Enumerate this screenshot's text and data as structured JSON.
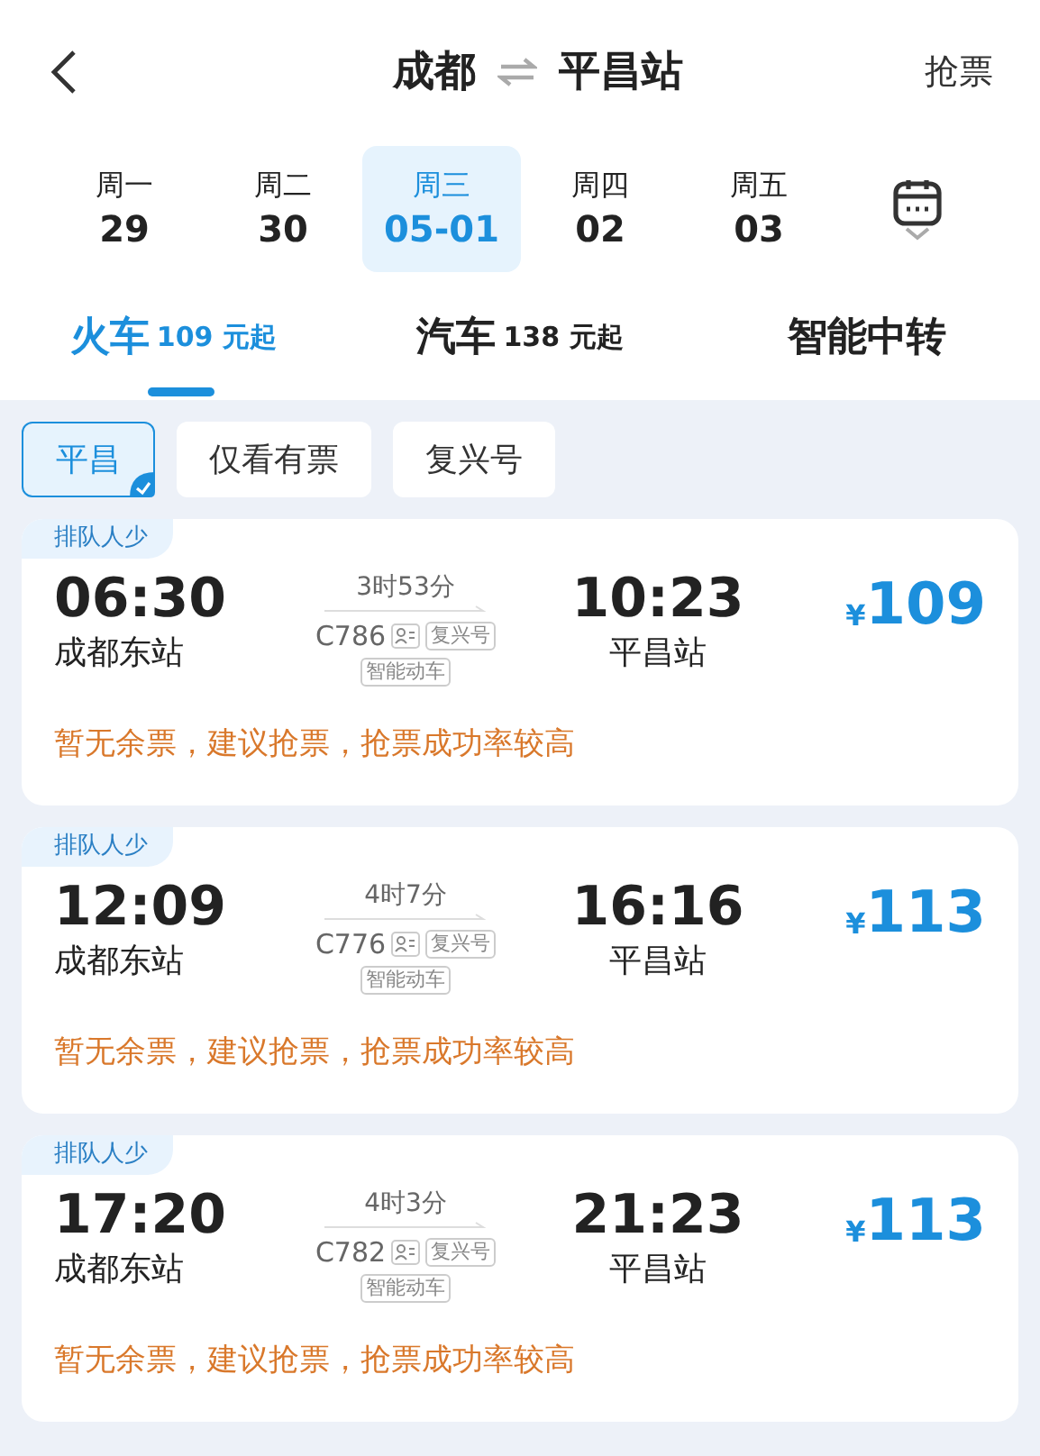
{
  "header": {
    "from": "成都",
    "to": "平昌站",
    "action": "抢票"
  },
  "dates": [
    {
      "weekday": "周一",
      "date": "29",
      "selected": false
    },
    {
      "weekday": "周二",
      "date": "30",
      "selected": false
    },
    {
      "weekday": "周三",
      "date": "05-01",
      "selected": true
    },
    {
      "weekday": "周四",
      "date": "02",
      "selected": false
    },
    {
      "weekday": "周五",
      "date": "03",
      "selected": false
    }
  ],
  "modes": [
    {
      "label": "火车",
      "price": "109 元起",
      "selected": true
    },
    {
      "label": "汽车",
      "price": "138 元起",
      "selected": false
    },
    {
      "label": "智能中转",
      "selected": false
    }
  ],
  "filters": [
    {
      "label": "平昌",
      "selected": true
    },
    {
      "label": "仅看有票",
      "selected": false
    },
    {
      "label": "复兴号",
      "selected": false
    }
  ],
  "trains": [
    {
      "badge": "排队人少",
      "depart_time": "06:30",
      "depart_station": "成都东站",
      "duration": "3时53分",
      "number": "C786",
      "tags": [
        "复兴号",
        "智能动车"
      ],
      "arrive_time": "10:23",
      "arrive_station": "平昌站",
      "currency": "¥",
      "price": "109",
      "notice": "暂无余票，建议抢票，抢票成功率较高"
    },
    {
      "badge": "排队人少",
      "depart_time": "12:09",
      "depart_station": "成都东站",
      "duration": "4时7分",
      "number": "C776",
      "tags": [
        "复兴号",
        "智能动车"
      ],
      "arrive_time": "16:16",
      "arrive_station": "平昌站",
      "currency": "¥",
      "price": "113",
      "notice": "暂无余票，建议抢票，抢票成功率较高"
    },
    {
      "badge": "排队人少",
      "depart_time": "17:20",
      "depart_station": "成都东站",
      "duration": "4时3分",
      "number": "C782",
      "tags": [
        "复兴号",
        "智能动车"
      ],
      "arrive_time": "21:23",
      "arrive_station": "平昌站",
      "currency": "¥",
      "price": "113",
      "notice": "暂无余票，建议抢票，抢票成功率较高"
    }
  ]
}
